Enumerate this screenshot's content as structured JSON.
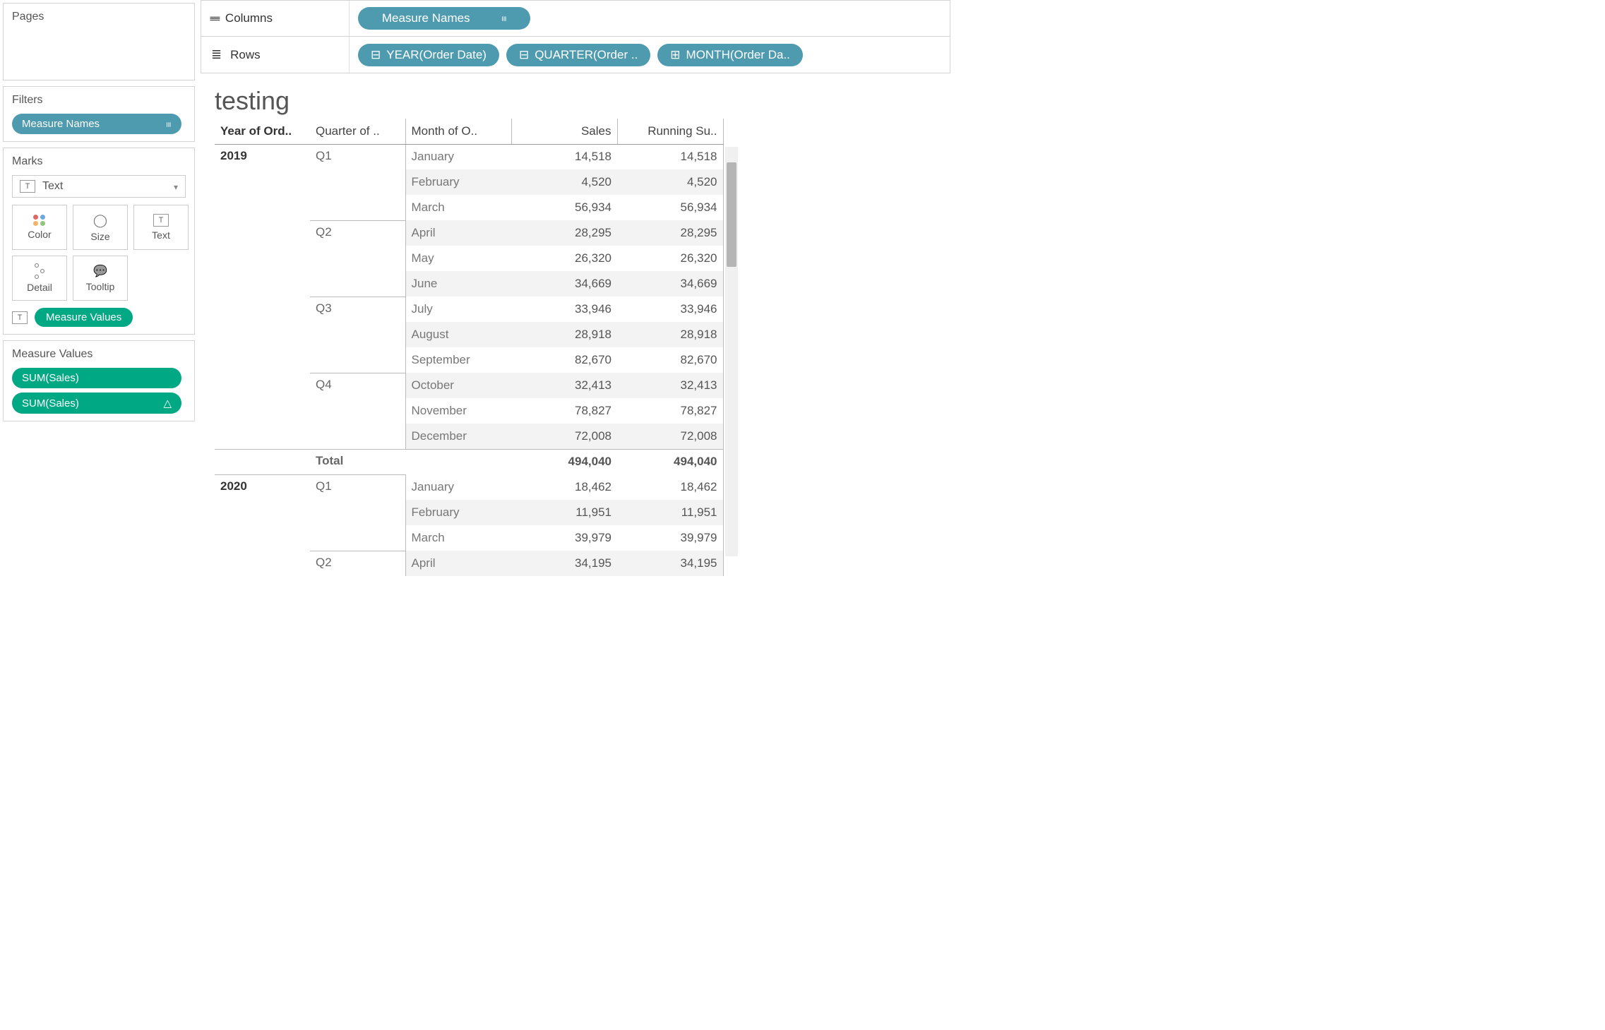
{
  "left": {
    "pages_label": "Pages",
    "filters_label": "Filters",
    "filters_pill": "Measure Names",
    "marks_label": "Marks",
    "marks_type": "Text",
    "marks_buttons": [
      "Color",
      "Size",
      "Text",
      "Detail",
      "Tooltip"
    ],
    "marks_text_pill": "Measure Values",
    "mv_label": "Measure Values",
    "mv_items": [
      "SUM(Sales)",
      "SUM(Sales)"
    ]
  },
  "shelves": {
    "columns_label": "Columns",
    "rows_label": "Rows",
    "columns_pills": [
      {
        "label": "Measure Names",
        "icon": "bars"
      }
    ],
    "rows_pills": [
      {
        "label": "YEAR(Order Date)",
        "icon": "minus"
      },
      {
        "label": "QUARTER(Order ..",
        "icon": "minus"
      },
      {
        "label": "MONTH(Order Da..",
        "icon": "plus"
      }
    ]
  },
  "sheet": {
    "title": "testing",
    "headers": [
      "Year of Ord..",
      "Quarter of ..",
      "Month of O..",
      "Sales",
      "Running Su.."
    ],
    "rows": [
      {
        "year": "2019",
        "quarter": "Q1",
        "month": "January",
        "sales": "14,518",
        "run": "14,518",
        "alt": false,
        "newQ": true,
        "newY": true
      },
      {
        "year": "",
        "quarter": "",
        "month": "February",
        "sales": "4,520",
        "run": "4,520",
        "alt": true
      },
      {
        "year": "",
        "quarter": "",
        "month": "March",
        "sales": "56,934",
        "run": "56,934",
        "alt": false
      },
      {
        "year": "",
        "quarter": "Q2",
        "month": "April",
        "sales": "28,295",
        "run": "28,295",
        "alt": true,
        "newQ": true
      },
      {
        "year": "",
        "quarter": "",
        "month": "May",
        "sales": "26,320",
        "run": "26,320",
        "alt": false
      },
      {
        "year": "",
        "quarter": "",
        "month": "June",
        "sales": "34,669",
        "run": "34,669",
        "alt": true
      },
      {
        "year": "",
        "quarter": "Q3",
        "month": "July",
        "sales": "33,946",
        "run": "33,946",
        "alt": false,
        "newQ": true
      },
      {
        "year": "",
        "quarter": "",
        "month": "August",
        "sales": "28,918",
        "run": "28,918",
        "alt": true
      },
      {
        "year": "",
        "quarter": "",
        "month": "September",
        "sales": "82,670",
        "run": "82,670",
        "alt": false
      },
      {
        "year": "",
        "quarter": "Q4",
        "month": "October",
        "sales": "32,413",
        "run": "32,413",
        "alt": true,
        "newQ": true
      },
      {
        "year": "",
        "quarter": "",
        "month": "November",
        "sales": "78,827",
        "run": "78,827",
        "alt": false
      },
      {
        "year": "",
        "quarter": "",
        "month": "December",
        "sales": "72,008",
        "run": "72,008",
        "alt": true
      },
      {
        "year": "",
        "quarter": "Total",
        "month": "",
        "sales": "494,040",
        "run": "494,040",
        "total": true
      },
      {
        "year": "2020",
        "quarter": "Q1",
        "month": "January",
        "sales": "18,462",
        "run": "18,462",
        "alt": false,
        "newQ": true,
        "newY": true
      },
      {
        "year": "",
        "quarter": "",
        "month": "February",
        "sales": "11,951",
        "run": "11,951",
        "alt": true
      },
      {
        "year": "",
        "quarter": "",
        "month": "March",
        "sales": "39,979",
        "run": "39,979",
        "alt": false
      },
      {
        "year": "",
        "quarter": "Q2",
        "month": "April",
        "sales": "34,195",
        "run": "34,195",
        "alt": true,
        "newQ": true
      }
    ]
  },
  "chart_data": {
    "type": "table",
    "title": "testing",
    "columns": [
      "Year",
      "Quarter",
      "Month",
      "Sales",
      "Running Sum of Sales"
    ],
    "data": [
      [
        "2019",
        "Q1",
        "January",
        14518,
        14518
      ],
      [
        "2019",
        "Q1",
        "February",
        4520,
        4520
      ],
      [
        "2019",
        "Q1",
        "March",
        56934,
        56934
      ],
      [
        "2019",
        "Q2",
        "April",
        28295,
        28295
      ],
      [
        "2019",
        "Q2",
        "May",
        26320,
        26320
      ],
      [
        "2019",
        "Q2",
        "June",
        34669,
        34669
      ],
      [
        "2019",
        "Q3",
        "July",
        33946,
        33946
      ],
      [
        "2019",
        "Q3",
        "August",
        28918,
        28918
      ],
      [
        "2019",
        "Q3",
        "September",
        82670,
        82670
      ],
      [
        "2019",
        "Q4",
        "October",
        32413,
        32413
      ],
      [
        "2019",
        "Q4",
        "November",
        78827,
        78827
      ],
      [
        "2019",
        "Q4",
        "December",
        72008,
        72008
      ],
      [
        "2019",
        "Total",
        "",
        494040,
        494040
      ],
      [
        "2020",
        "Q1",
        "January",
        18462,
        18462
      ],
      [
        "2020",
        "Q1",
        "February",
        11951,
        11951
      ],
      [
        "2020",
        "Q1",
        "March",
        39979,
        39979
      ],
      [
        "2020",
        "Q2",
        "April",
        34195,
        34195
      ]
    ]
  }
}
